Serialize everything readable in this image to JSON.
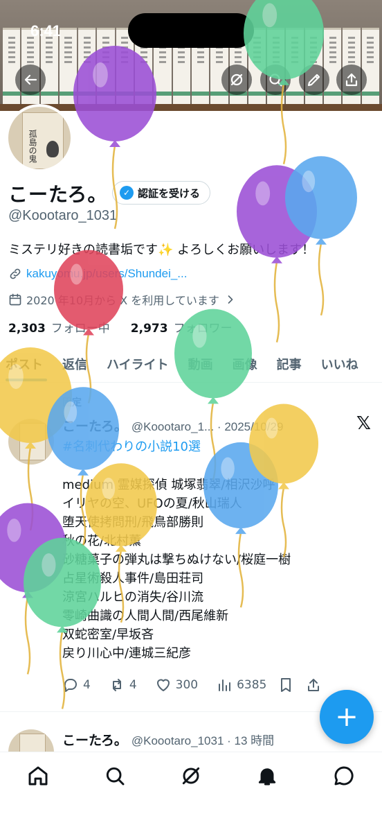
{
  "status": {
    "time": "6:41"
  },
  "header": {
    "back_icon": "arrow-left-icon",
    "grok_icon": "grok-icon",
    "search_icon": "search-icon",
    "edit_icon": "pencil-icon",
    "share_icon": "share-icon"
  },
  "profile": {
    "avatar_cover_title": "孤島の鬼",
    "display_name": "こーたろ。",
    "verify_label": "認証を受ける",
    "handle": "@Koootaro_1031",
    "bio": "ミステリ好きの読書垢です✨ よろしくお願いします！",
    "link": "kakuyomu.jp/users/Shundei_...",
    "joined": "2020 年10月から X を利用しています",
    "following_count": "2,303",
    "following_label": "フォロー中",
    "followers_count": "2,973",
    "followers_label": "フォロワー"
  },
  "tabs": [
    "ポスト",
    "返信",
    "ハイライト",
    "動画",
    "画像",
    "記事",
    "いいね"
  ],
  "pinned_post": {
    "pinned_label": "固定",
    "name": "こーたろ。",
    "meta": "@Koootaro_1... · 2025/10/29",
    "hashtag": "#名刺代わりの小説10選",
    "lines": [
      "medium 霊媒探偵 城塚翡翠/相沢沙呼",
      "イリヤの空、UFOの夏/秋山瑞人",
      "堕天使拷問刑/飛鳥部勝則",
      "秋の花/北村薫",
      "砂糖菓子の弾丸は撃ちぬけない/桜庭一樹",
      "占星術殺人事件/島田荘司",
      "涼宮ハルヒの消失/谷川流",
      "零崎曲識の人間人間/西尾維新",
      "双蛇密室/早坂吝",
      "戻り川心中/連城三紀彦"
    ],
    "replies": "4",
    "reposts": "4",
    "likes": "300",
    "views": "6385"
  },
  "second_post": {
    "name": "こーたろ。",
    "meta": "@Koootaro_1031 · 13 時間"
  },
  "fab_label": "+",
  "nav": [
    "home-icon",
    "search-icon",
    "grok-icon",
    "notifications-icon",
    "messages-icon"
  ],
  "balloon_colors": {
    "purple": "#9b4fd6",
    "green": "#5fd39a",
    "blue": "#5aa8ee",
    "red": "#e0455c",
    "yellow": "#f2c94c"
  }
}
